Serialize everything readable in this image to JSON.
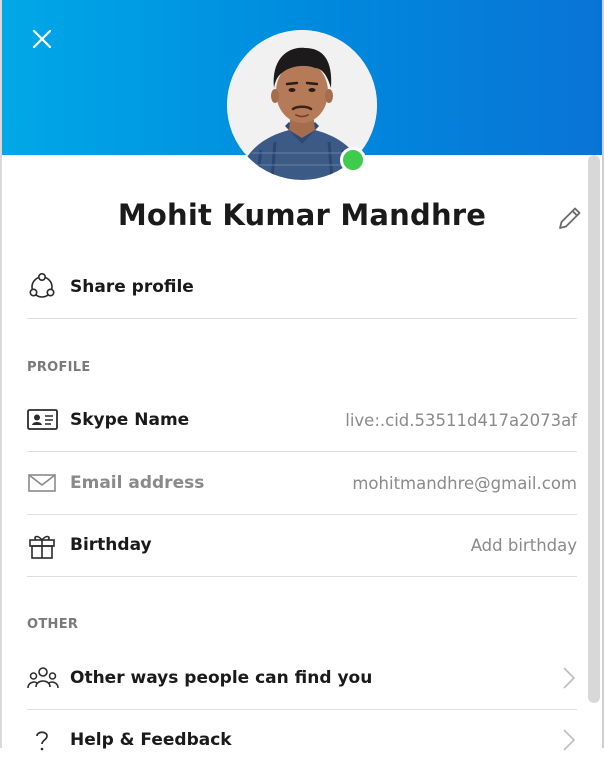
{
  "profile": {
    "name": "Mohit Kumar Mandhre",
    "status": "online"
  },
  "share": {
    "label": "Share profile"
  },
  "sections": {
    "profile": "PROFILE",
    "other": "OTHER"
  },
  "fields": {
    "skype_name": {
      "label": "Skype Name",
      "value": "live:.cid.53511d417a2073af"
    },
    "email": {
      "label": "Email address",
      "value": "mohitmandhre@gmail.com"
    },
    "birthday": {
      "label": "Birthday",
      "value": "Add birthday"
    }
  },
  "other": {
    "find_you": "Other ways people can find you",
    "help": "Help & Feedback"
  },
  "colors": {
    "header_start": "#00a9e8",
    "header_end": "#0a74d6",
    "status_online": "#3fcb4c"
  },
  "icons": [
    "close-icon",
    "edit-icon",
    "share-icon",
    "id-card-icon",
    "mail-icon",
    "gift-icon",
    "people-icon",
    "question-icon",
    "chevron-right-icon"
  ]
}
